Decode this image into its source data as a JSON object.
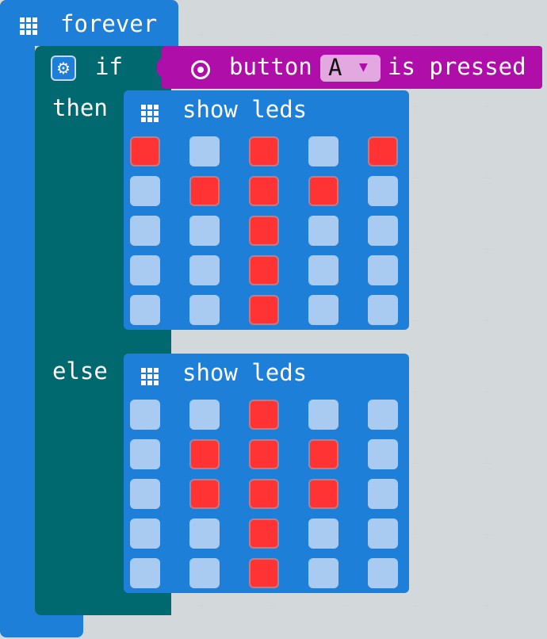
{
  "forever": {
    "label": "forever"
  },
  "if_block": {
    "if_label": "if",
    "then_label": "then",
    "else_label": "else",
    "condition": {
      "prefix": "button",
      "button_value": "A",
      "suffix": "is pressed"
    }
  },
  "then_block": {
    "label": "show leds",
    "leds": [
      [
        1,
        0,
        1,
        0,
        1
      ],
      [
        0,
        1,
        1,
        1,
        0
      ],
      [
        0,
        0,
        1,
        0,
        0
      ],
      [
        0,
        0,
        1,
        0,
        0
      ],
      [
        0,
        0,
        1,
        0,
        0
      ]
    ]
  },
  "else_block": {
    "label": "show leds",
    "leds": [
      [
        0,
        0,
        1,
        0,
        0
      ],
      [
        0,
        1,
        1,
        1,
        0
      ],
      [
        0,
        1,
        1,
        1,
        0
      ],
      [
        0,
        0,
        1,
        0,
        0
      ],
      [
        0,
        0,
        1,
        0,
        0
      ]
    ]
  },
  "colors": {
    "loops": "#1e7fd8",
    "logic": "#006970",
    "input": "#b00ea8",
    "led_on": "#ff3333",
    "led_off": "#a9cbf1",
    "workspace": "#ecf0f1"
  },
  "icons": {
    "forever": "grid-icon",
    "if": "gear-icon",
    "condition": "radio-icon",
    "show_leds": "grid-icon"
  }
}
